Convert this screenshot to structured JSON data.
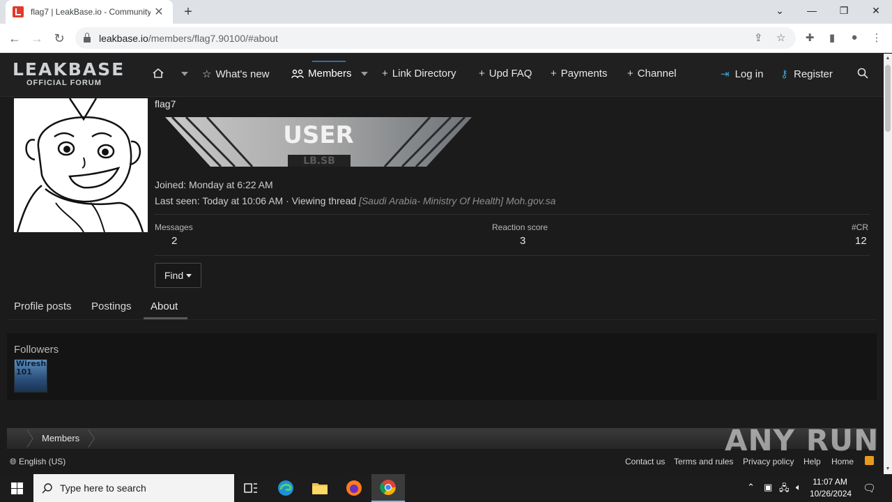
{
  "browser": {
    "tab_title": "flag7 | LeakBase.io - Community",
    "url_domain": "leakbase.io",
    "url_path": "/members/flag7.90100/#about"
  },
  "site": {
    "logo_line1": "LEAKBASE",
    "logo_line2": "OFFICIAL FORUM",
    "nav": {
      "whats_new": "What's new",
      "members": "Members",
      "link_directory": "Link Directory",
      "upd_faq": "Upd FAQ",
      "payments": "Payments",
      "channel": "Channel",
      "login": "Log in",
      "register": "Register"
    }
  },
  "profile": {
    "username": "flag7",
    "banner_text": "USER",
    "banner_sub": "LB.SB",
    "joined_label": "Joined:",
    "joined_value": "Monday at 6:22 AM",
    "lastseen_label": "Last seen:",
    "lastseen_value": "Today at 10:06 AM",
    "lastseen_sep": "·",
    "lastseen_activity": "Viewing thread",
    "lastseen_thread": "[Saudi Arabia- Ministry Of Health] Moh.gov.sa",
    "stats": [
      {
        "label": "Messages",
        "value": "2"
      },
      {
        "label": "Reaction score",
        "value": "3"
      },
      {
        "label": "#CR",
        "value": "12"
      }
    ],
    "find_label": "Find",
    "tabs": [
      "Profile posts",
      "Postings",
      "About"
    ],
    "active_tab": "About",
    "followers_title": "Followers",
    "follower_avatar_text": "Wiresh 101"
  },
  "breadcrumb": {
    "item": "Members"
  },
  "footer": {
    "language": "English (US)",
    "links": [
      "Contact us",
      "Terms and rules",
      "Privacy policy",
      "Help",
      "Home"
    ]
  },
  "watermark": "ANY RUN",
  "taskbar": {
    "search_placeholder": "Type here to search",
    "time": "11:07 AM",
    "date": "10/26/2024"
  }
}
